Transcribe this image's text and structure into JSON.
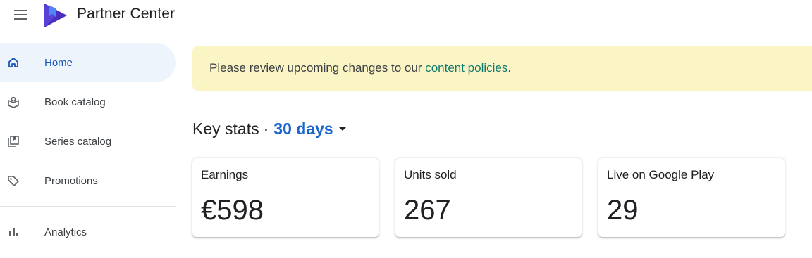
{
  "header": {
    "app_title": "Partner Center",
    "menu_icon": "hamburger-menu-icon",
    "logo": "google-play-books-logo"
  },
  "sidebar": {
    "items": [
      {
        "label": "Home",
        "icon": "home-icon",
        "active": true
      },
      {
        "label": "Book catalog",
        "icon": "open-book-icon"
      },
      {
        "label": "Series catalog",
        "icon": "library-stack-icon"
      },
      {
        "label": "Promotions",
        "icon": "price-tag-icon"
      },
      {
        "label": "Analytics",
        "icon": "bar-chart-icon"
      }
    ]
  },
  "banner": {
    "text_before": "Please review upcoming changes to our ",
    "link_text": "content policies",
    "text_after": "."
  },
  "stats": {
    "heading": "Key stats",
    "separator": "·",
    "period": "30 days",
    "cards": [
      {
        "label": "Earnings",
        "value": "€598"
      },
      {
        "label": "Units sold",
        "value": "267"
      },
      {
        "label": "Live on Google Play",
        "value": "29"
      }
    ]
  },
  "colors": {
    "accent": "#1a66cc",
    "active_nav_bg": "#eef4fc",
    "banner_bg": "#fbf4c5",
    "link": "#0f7b6c"
  }
}
